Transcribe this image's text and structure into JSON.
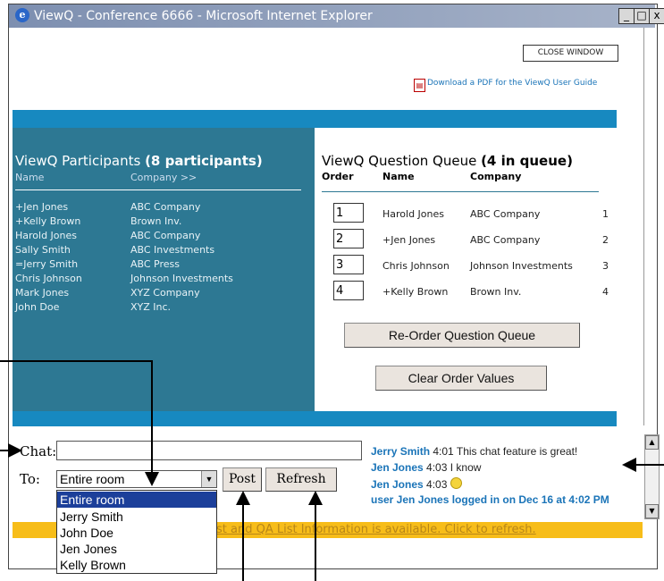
{
  "window": {
    "title": "ViewQ - Conference 6666 - Microsoft Internet Explorer",
    "ie_icon": "e",
    "controls": {
      "minimize": "_",
      "maximize": "□",
      "close": "x"
    }
  },
  "header": {
    "close_button": "CLOSE WINDOW",
    "pdf_link": "Download a PDF for the ViewQ User Guide",
    "pdf_icon": "pdf-icon"
  },
  "participants": {
    "title": "ViewQ Participants ",
    "count": "(8 participants)",
    "col_name": "Name",
    "col_company": "Company >>",
    "rows": [
      {
        "name": "+Jen Jones",
        "company": "ABC Company"
      },
      {
        "name": "+Kelly Brown",
        "company": "Brown Inv."
      },
      {
        "name": "Harold Jones",
        "company": "ABC Company"
      },
      {
        "name": "Sally Smith",
        "company": "ABC Investments"
      },
      {
        "name": "=Jerry Smith",
        "company": "ABC Press"
      },
      {
        "name": "Chris Johnson",
        "company": "Johnson Investments"
      },
      {
        "name": "Mark Jones",
        "company": "XYZ Company"
      },
      {
        "name": "John Doe",
        "company": "XYZ Inc."
      }
    ]
  },
  "queue": {
    "title": "ViewQ Question Queue ",
    "count": "(4 in queue)",
    "col_order": "Order",
    "col_name": "Name",
    "col_company": "Company",
    "rows": [
      {
        "order": "1",
        "name": "Harold Jones",
        "company": "ABC Company",
        "pos": "1"
      },
      {
        "order": "2",
        "name": "+Jen Jones",
        "company": "ABC Company",
        "pos": "2"
      },
      {
        "order": "3",
        "name": "Chris Johnson",
        "company": "Johnson Investments",
        "pos": "3"
      },
      {
        "order": "4",
        "name": "+Kelly Brown",
        "company": "Brown Inv.",
        "pos": "4"
      }
    ],
    "reorder_button": "Re-Order Question Queue",
    "clear_button": "Clear Order Values"
  },
  "chat": {
    "chat_label": "Chat:",
    "chat_value": "",
    "to_label": "To:",
    "to_selected": "Entire room",
    "options": [
      "Entire room",
      "Jerry Smith",
      "John Doe",
      "Jen Jones",
      "Kelly Brown"
    ],
    "post_button": "Post",
    "refresh_button": "Refresh",
    "messages": [
      {
        "who": "Jerry Smith",
        "time": "4:01",
        "text": "This chat feature is great!"
      },
      {
        "who": "Jen Jones",
        "time": "4:03",
        "text": "I know"
      },
      {
        "who": "Jen Jones",
        "time": "4:03",
        "text": ""
      },
      {
        "system": "user Jen Jones logged in on Dec 16 at 4:02 PM"
      }
    ],
    "notice": "st and QA List Information is available. Click to refresh."
  }
}
